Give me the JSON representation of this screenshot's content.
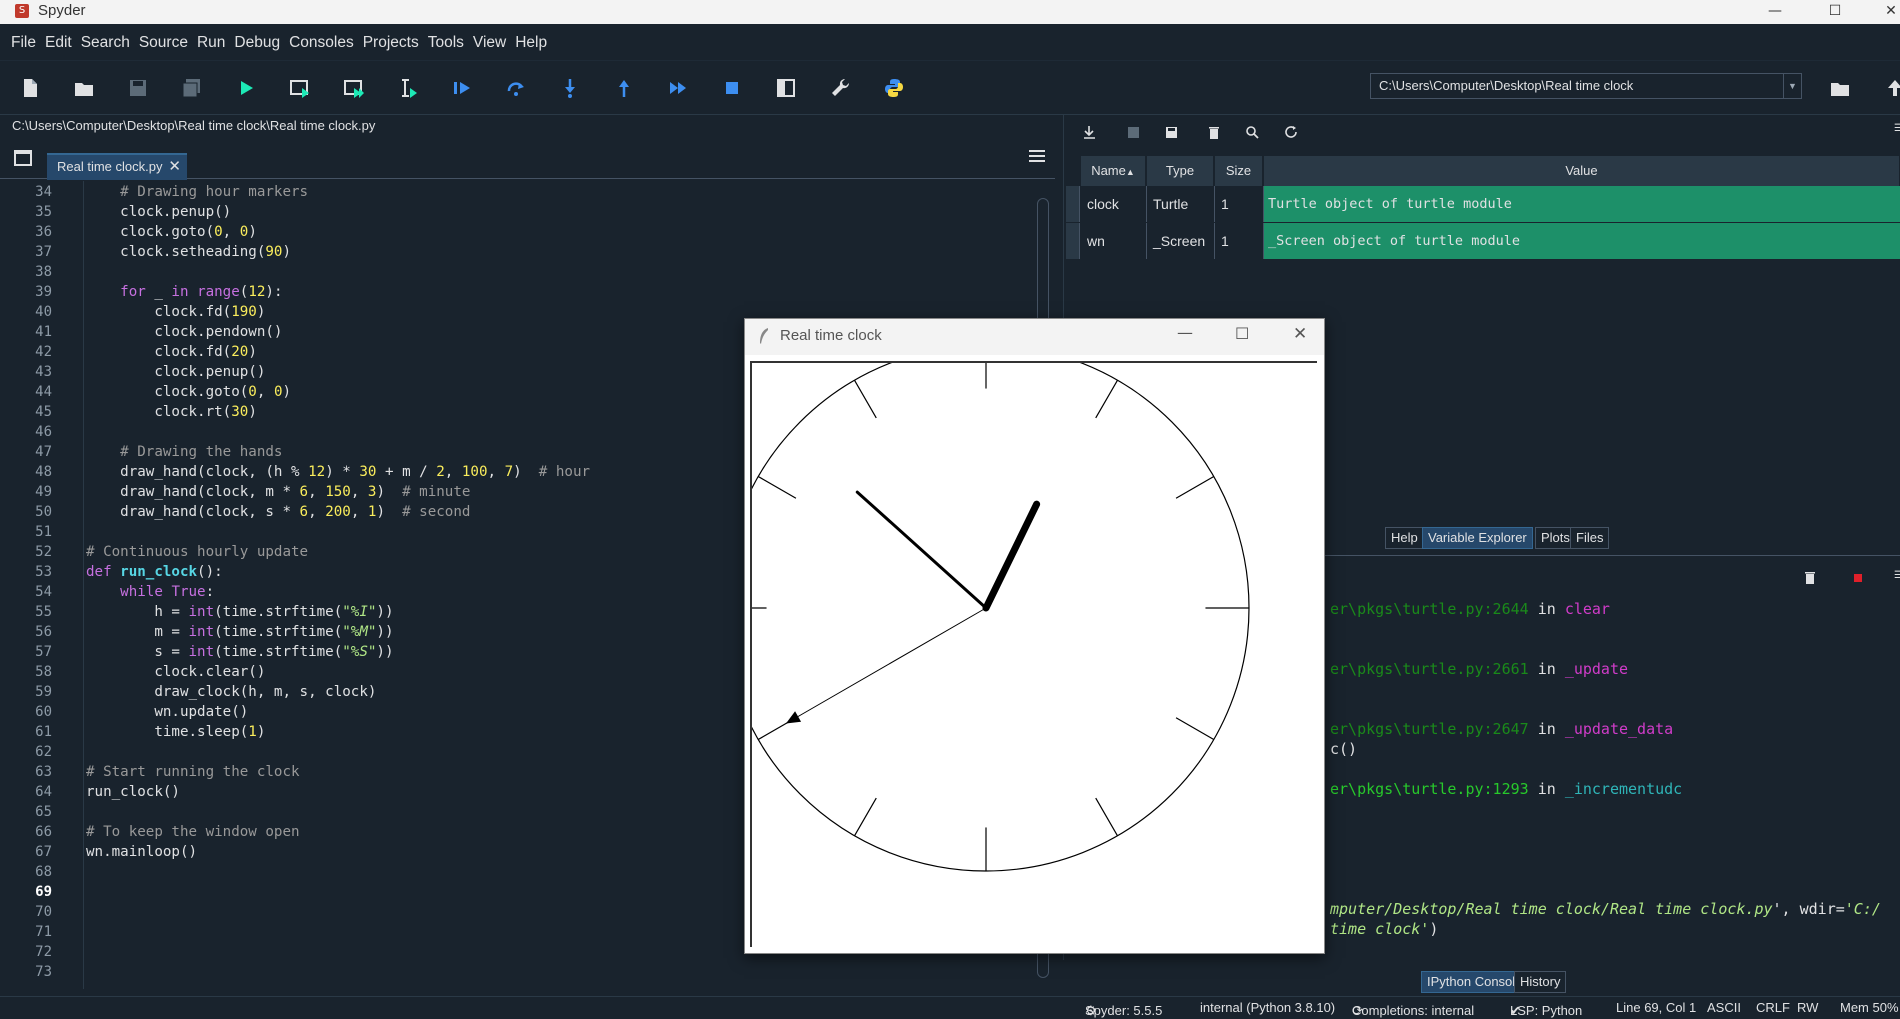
{
  "window": {
    "title": "Spyder",
    "controls": [
      "minimize",
      "maximize",
      "close"
    ]
  },
  "menu": [
    "File",
    "Edit",
    "Search",
    "Source",
    "Run",
    "Debug",
    "Consoles",
    "Projects",
    "Tools",
    "View",
    "Help"
  ],
  "toolbar": {
    "working_directory": "C:\\Users\\Computer\\Desktop\\Real time clock"
  },
  "editor": {
    "file_path": "C:\\Users\\Computer\\Desktop\\Real time clock\\Real time clock.py",
    "tab_label": "Real time clock.py",
    "first_line_number": 34,
    "current_line": 69,
    "line_numbers": [
      "34",
      "35",
      "36",
      "37",
      "38",
      "39",
      "40",
      "41",
      "42",
      "43",
      "44",
      "45",
      "46",
      "47",
      "48",
      "49",
      "50",
      "51",
      "52",
      "53",
      "54",
      "55",
      "56",
      "57",
      "58",
      "59",
      "60",
      "61",
      "62",
      "63",
      "64",
      "65",
      "66",
      "67",
      "68",
      "69",
      "70",
      "71",
      "72",
      "73"
    ],
    "lines": [
      "    # Drawing hour markers",
      "    clock.penup()",
      "    clock.goto(0, 0)",
      "    clock.setheading(90)",
      "",
      "    for _ in range(12):",
      "        clock.fd(190)",
      "        clock.pendown()",
      "        clock.fd(20)",
      "        clock.penup()",
      "        clock.goto(0, 0)",
      "        clock.rt(30)",
      "",
      "    # Drawing the hands",
      "    draw_hand(clock, (h % 12) * 30 + m / 2, 100, 7)  # hour",
      "    draw_hand(clock, m * 6, 150, 3)  # minute",
      "    draw_hand(clock, s * 6, 200, 1)  # second",
      "",
      "# Continuous hourly update",
      "def run_clock():",
      "    while True:",
      "        h = int(time.strftime(\"%I\"))",
      "        m = int(time.strftime(\"%M\"))",
      "        s = int(time.strftime(\"%S\"))",
      "        clock.clear()",
      "        draw_clock(h, m, s, clock)",
      "        wn.update()",
      "        time.sleep(1)",
      "",
      "# Start running the clock",
      "run_clock()",
      "",
      "# To keep the window open",
      "wn.mainloop()",
      "",
      "",
      "",
      "",
      "",
      ""
    ]
  },
  "variable_explorer": {
    "columns": [
      "Name",
      "Type",
      "Size",
      "Value"
    ],
    "rows": [
      {
        "name": "clock",
        "type": "Turtle",
        "size": "1",
        "value": "Turtle object of turtle module"
      },
      {
        "name": "wn",
        "type": "_Screen",
        "size": "1",
        "value": "_Screen object of turtle module"
      }
    ],
    "tabs": [
      "Help",
      "Variable Explorer",
      "Plots",
      "Files"
    ],
    "active_tab": "Variable Explorer"
  },
  "console": {
    "lines": [
      {
        "path": "er\\pkgs\\turtle.py:2644",
        "in": " in ",
        "fn": "clear",
        "style": 1
      },
      {
        "path": "er\\pkgs\\turtle.py:2661",
        "in": " in ",
        "fn": "_update",
        "style": 1
      },
      {
        "path": "er\\pkgs\\turtle.py:2647",
        "in": " in ",
        "fn": "_update_data",
        "style": 1
      },
      {
        "text": "c()"
      },
      {
        "path": "er\\pkgs\\turtle.py:1293",
        "in": " in ",
        "fn": "_incrementudc",
        "style": 2
      }
    ],
    "run_line_1": "mputer/Desktop/Real time clock/Real time clock.py",
    "run_line_1_suffix": "', wdir=",
    "run_line_1_wdir": "'C:/",
    "run_line_2": "time clock'",
    "run_line_2_suffix": ")",
    "tabs": [
      "IPython Console",
      "History"
    ],
    "active_tab": "IPython Console"
  },
  "turtle_window": {
    "title": "Real time clock",
    "clock": {
      "hour": 12,
      "minute": 52,
      "second": 40
    }
  },
  "statusbar": {
    "spyder": "Spyder: 5.5.5",
    "interpreter": "internal (Python 3.8.10)",
    "completions": "Completions: internal",
    "lsp": "LSP: Python",
    "position": "Line 69, Col 1",
    "encoding": "ASCII",
    "eol": "CRLF",
    "permissions": "RW",
    "memory": "Mem 50%"
  },
  "colors": {
    "background": "#19232d",
    "accent": "#26486b",
    "variable_row": "#1d9069"
  }
}
